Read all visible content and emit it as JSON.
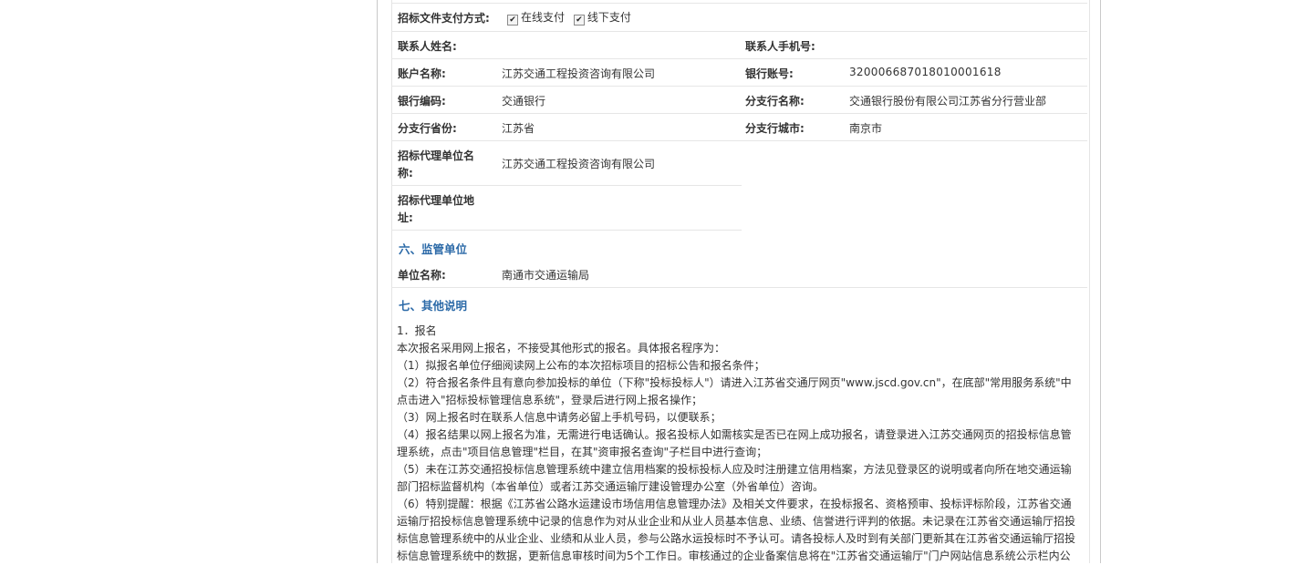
{
  "payment": {
    "label": "招标文件支付方式:",
    "online": "在线支付",
    "offline": "线下支付"
  },
  "contact": {
    "name_label": "联系人姓名:",
    "name_value": "",
    "phone_label": "联系人手机号:",
    "phone_value": ""
  },
  "account": {
    "name_label": "账户名称:",
    "name_value": "江苏交通工程投资咨询有限公司",
    "bank_no_label": "银行账号:",
    "bank_no_value": "320006687018010001618"
  },
  "bank": {
    "code_label": "银行编码:",
    "code_value": "交通银行",
    "branch_label": "分支行名称:",
    "branch_value": "交通银行股份有限公司江苏省分行营业部"
  },
  "branch": {
    "province_label": "分支行省份:",
    "province_value": "江苏省",
    "city_label": "分支行城市:",
    "city_value": "南京市"
  },
  "agency": {
    "name_label_1": "招标代理单位名",
    "name_label_2": "称:",
    "name_value": "江苏交通工程投资咨询有限公司",
    "addr_label_1": "招标代理单位地",
    "addr_label_2": "址:",
    "addr_value": ""
  },
  "section6": {
    "title": "六、监管单位",
    "unit_label": "单位名称:",
    "unit_value": "南通市交通运输局"
  },
  "section7": {
    "title": "七、其他说明",
    "lines": [
      "1．报名",
      "本次报名采用网上报名，不接受其他形式的报名。具体报名程序为：",
      "（1）拟报名单位仔细阅读网上公布的本次招标项目的招标公告和报名条件；",
      "（2）符合报名条件且有意向参加投标的单位（下称\"投标投标人\"）请进入江苏省交通厅网页\"www.jscd.gov.cn\"，在底部\"常用服务系统\"中",
      "点击进入\"招标投标管理信息系统\"，登录后进行网上报名操作；",
      "（3）网上报名时在联系人信息中请务必留上手机号码，以便联系；",
      "（4）报名结果以网上报名为准，无需进行电话确认。报名投标人如需核实是否已在网上成功报名，请登录进入江苏交通网页的招投标信息管",
      "理系统，点击\"项目信息管理\"栏目，在其\"资审报名查询\"子栏目中进行查询；",
      "（5）未在江苏交通招投标信息管理系统中建立信用档案的投标投标人应及时注册建立信用档案，方法见登录区的说明或者向所在地交通运输",
      "部门招标监督机构（本省单位）或者江苏交通运输厅建设管理办公室（外省单位）咨询。",
      "（6）特别提醒：根据《江苏省公路水运建设市场信用信息管理办法》及相关文件要求，在投标报名、资格预审、投标评标阶段，江苏省交通",
      "运输厅招投标信息管理系统中记录的信息作为对从业企业和从业人员基本信息、业绩、信誉进行评判的依据。未记录在江苏省交通运输厅招投",
      "标信息管理系统中的从业企业、业绩和从业人员，参与公路水运投标时不予认可。请各投标人及时到有关部门更新其在江苏省交通运输厅招投",
      "标信息管理系统中的数据，更新信息审核时间为5个工作日。审核通过的企业备案信息将在\"江苏省交通运输厅\"门户网站信息系统公示栏内公"
    ]
  }
}
